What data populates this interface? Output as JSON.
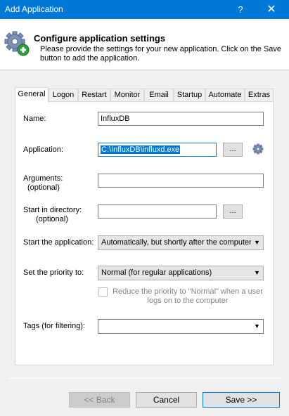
{
  "window": {
    "title": "Add Application",
    "help_glyph": "?",
    "close_glyph": "✕"
  },
  "header": {
    "title": "Configure application settings",
    "description": "Please provide the settings for your new application. Click on the Save button to add the application.",
    "icon": "gear-add-icon"
  },
  "tabs": [
    {
      "label": "General",
      "active": true
    },
    {
      "label": "Logon"
    },
    {
      "label": "Restart"
    },
    {
      "label": "Monitor"
    },
    {
      "label": "Email"
    },
    {
      "label": "Startup"
    },
    {
      "label": "Automate"
    },
    {
      "label": "Extras"
    }
  ],
  "form": {
    "name_label": "Name:",
    "name_value": "InfluxDB",
    "application_label": "Application:",
    "application_value": "C:\\InfluxDB\\influxd.exe",
    "browse_label": "...",
    "arguments_label": "Arguments:",
    "arguments_optional": "(optional)",
    "arguments_value": "",
    "startdir_label": "Start in directory:",
    "startdir_optional": "(optional)",
    "startdir_value": "",
    "start_app_label": "Start the application:",
    "start_app_value": "Automatically, but shortly after the computer b",
    "priority_label": "Set the priority to:",
    "priority_value": "Normal (for regular applications)",
    "reduce_priority_text": "Reduce the priority to \"Normal\" when a user logs on to the computer",
    "tags_label": "Tags (for filtering):",
    "tags_value": ""
  },
  "footer": {
    "back_label": "<< Back",
    "cancel_label": "Cancel",
    "save_label": "Save >>"
  },
  "colors": {
    "titlebar": "#0078d7",
    "selection": "#0078d7"
  }
}
